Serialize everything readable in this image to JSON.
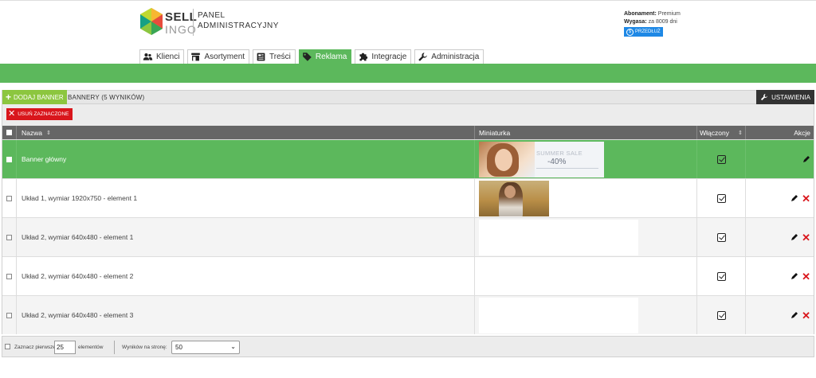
{
  "brand": {
    "name_line1": "SELL",
    "name_line2": "INGO",
    "panel_line1": "PANEL",
    "panel_line2": "ADMINISTRACYJNY"
  },
  "account": {
    "plan_label": "Abonament:",
    "plan_value": "Premium",
    "expires_label": "Wygasa:",
    "expires_value": "za 8009 dni",
    "extend_label": "PRZEDŁUŻ"
  },
  "nav": {
    "tabs": [
      {
        "label": "Klienci",
        "icon": "users-icon"
      },
      {
        "label": "Asortyment",
        "icon": "store-icon"
      },
      {
        "label": "Treści",
        "icon": "newspaper-icon"
      },
      {
        "label": "Reklama",
        "icon": "tag-icon",
        "active": true
      },
      {
        "label": "Integracje",
        "icon": "puzzle-icon"
      },
      {
        "label": "Administracja",
        "icon": "wrench-icon"
      }
    ]
  },
  "toolbar": {
    "add_label": "DODAJ BANNER",
    "title": "BANNERY (5 WYNIKÓW)",
    "settings_label": "USTAWIENIA",
    "delete_selected_label": "USUŃ ZAZNACZONE"
  },
  "table": {
    "headers": {
      "name": "Nazwa",
      "thumbnail": "Miniaturka",
      "enabled": "Włączony",
      "actions": "Akcje"
    },
    "rows": [
      {
        "name": "Banner główny",
        "thumb": "banner",
        "enabled": true,
        "selected": true,
        "deletable": false
      },
      {
        "name": "Układ 1, wymiar 1920x750 - element 1",
        "thumb": "photo",
        "enabled": true,
        "selected": false,
        "deletable": true
      },
      {
        "name": "Układ 2, wymiar 640x480 - element 1",
        "thumb": "blank",
        "enabled": true,
        "selected": false,
        "deletable": true
      },
      {
        "name": "Układ 2, wymiar 640x480 - element 2",
        "thumb": "blank",
        "enabled": true,
        "selected": false,
        "deletable": true
      },
      {
        "name": "Układ 2, wymiar 640x480 - element 3",
        "thumb": "blank",
        "enabled": true,
        "selected": false,
        "deletable": true
      }
    ],
    "banner_thumb": {
      "sale_text": "SUMMER SALE",
      "percent_text": "-40%"
    }
  },
  "footer": {
    "select_first_label": "Zaznacz pierwsze",
    "select_first_value": "25",
    "elements_label": "elementów",
    "per_page_label": "Wyników na stronę:",
    "per_page_value": "50"
  },
  "colors": {
    "accent_green": "#5cb85c",
    "add_button": "#8cc63f",
    "danger_red": "#d9161c",
    "extend_blue": "#1e88e5",
    "header_dark": "#666666"
  }
}
